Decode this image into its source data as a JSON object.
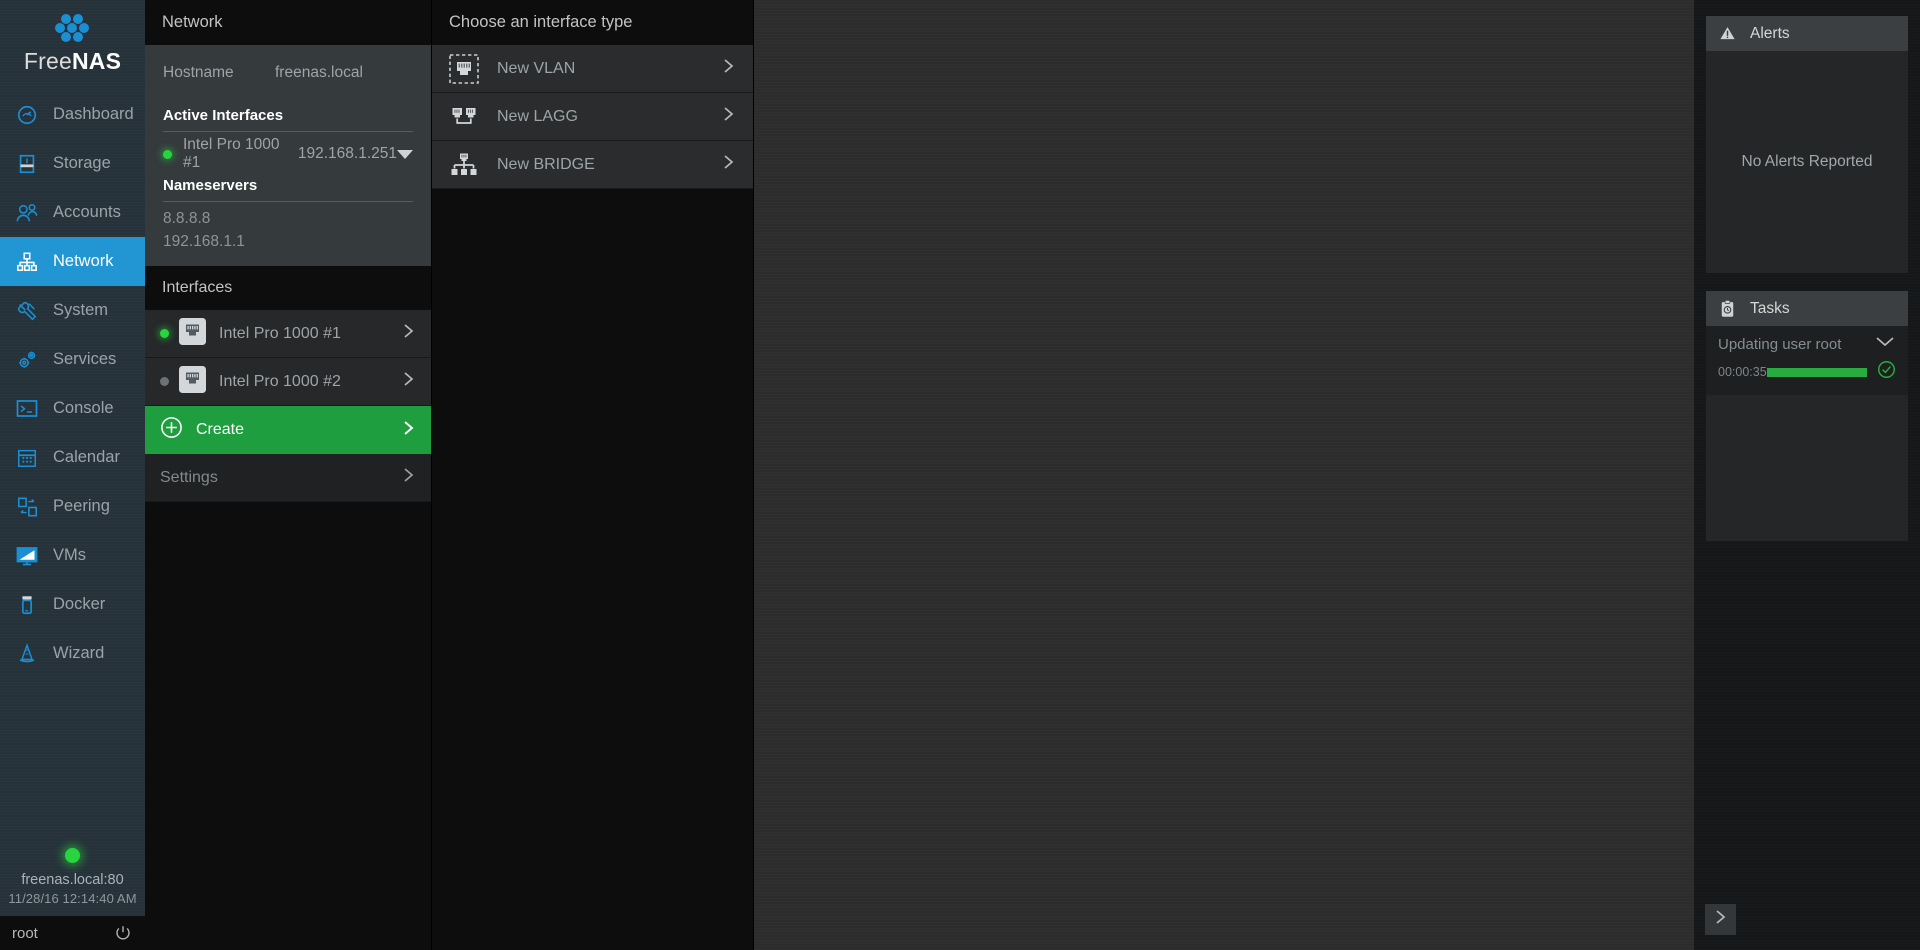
{
  "brand": {
    "free": "Free",
    "nas": "NAS",
    "logo_icon": "freenas-hex-logo"
  },
  "sidebar": {
    "items": [
      {
        "label": "Dashboard",
        "icon": "gauge-icon",
        "active": false
      },
      {
        "label": "Storage",
        "icon": "storage-icon",
        "active": false
      },
      {
        "label": "Accounts",
        "icon": "accounts-icon",
        "active": false
      },
      {
        "label": "Network",
        "icon": "network-icon",
        "active": true
      },
      {
        "label": "System",
        "icon": "wrench-icon",
        "active": false
      },
      {
        "label": "Services",
        "icon": "gears-icon",
        "active": false
      },
      {
        "label": "Console",
        "icon": "terminal-icon",
        "active": false
      },
      {
        "label": "Calendar",
        "icon": "calendar-icon",
        "active": false
      },
      {
        "label": "Peering",
        "icon": "peering-icon",
        "active": false
      },
      {
        "label": "VMs",
        "icon": "monitor-icon",
        "active": false
      },
      {
        "label": "Docker",
        "icon": "docker-icon",
        "active": false
      },
      {
        "label": "Wizard",
        "icon": "wizard-hat-icon",
        "active": false
      }
    ],
    "status": {
      "host": "freenas.local:80",
      "datetime": "11/28/16  12:14:40 AM",
      "dot_color": "#27d63e"
    },
    "user": {
      "name": "root",
      "power_icon": "power-icon"
    }
  },
  "network_panel": {
    "title": "Network",
    "hostname_label": "Hostname",
    "hostname_value": "freenas.local",
    "active_interfaces_title": "Active Interfaces",
    "active_interface": {
      "name": "Intel Pro 1000 #1",
      "ip": "192.168.1.251",
      "status": "up"
    },
    "nameservers_title": "Nameservers",
    "nameservers": [
      "8.8.8.8",
      "192.168.1.1"
    ],
    "interfaces_title": "Interfaces",
    "interfaces": [
      {
        "name": "Intel Pro 1000 #1",
        "status": "up",
        "icon": "rj45-icon"
      },
      {
        "name": "Intel Pro 1000 #2",
        "status": "down",
        "icon": "rj45-icon"
      }
    ],
    "create_label": "Create",
    "settings_label": "Settings"
  },
  "type_panel": {
    "title": "Choose an interface type",
    "options": [
      {
        "label": "New VLAN",
        "icon": "vlan-icon"
      },
      {
        "label": "New LAGG",
        "icon": "lagg-icon"
      },
      {
        "label": "New BRIDGE",
        "icon": "bridge-icon"
      }
    ]
  },
  "rail": {
    "alerts": {
      "title": "Alerts",
      "icon": "alert-triangle-icon",
      "empty_text": "No Alerts Reported"
    },
    "tasks": {
      "title": "Tasks",
      "icon": "clipboard-icon",
      "items": [
        {
          "name": "Updating user root",
          "time": "00:00:35",
          "progress": 100,
          "state": "complete"
        }
      ]
    },
    "toggle_icon": "chevron-right-icon"
  },
  "colors": {
    "accent_blue": "#2196d3",
    "accent_green": "#1e9e3e",
    "status_green": "#27d63e",
    "progress_green": "#29ac3f"
  }
}
